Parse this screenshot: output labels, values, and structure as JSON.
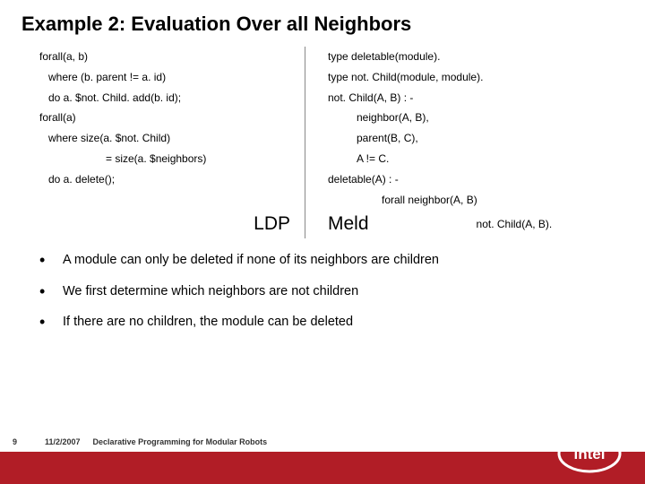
{
  "title": "Example 2: Evaluation Over all Neighbors",
  "left": {
    "l1": "forall(a, b)",
    "l2": "where (b. parent != a. id)",
    "l3": "do a. $not. Child. add(b. id);",
    "l4": "forall(a)",
    "l5": "where size(a. $not. Child)",
    "l6": "= size(a. $neighbors)",
    "l7": "do a. delete();"
  },
  "right": {
    "r1": "type deletable(module).",
    "r2": "type not. Child(module, module).",
    "r3": "not. Child(A, B) : -",
    "r4": "neighbor(A, B),",
    "r5": "parent(B, C),",
    "r6": "A != C.",
    "r7": "deletable(A) : -",
    "r8": "forall neighbor(A, B)",
    "r9": "not. Child(A, B)."
  },
  "lang": {
    "left": "LDP",
    "right": "Meld"
  },
  "bullets": {
    "b1": "A module can only be deleted if none of its neighbors are children",
    "b2": "We first determine which neighbors are not children",
    "b3": "If there are no children, the module can be deleted"
  },
  "footer": {
    "slide": "9",
    "date": "11/2/2007",
    "subtitle": "Declarative Programming for Modular Robots"
  }
}
